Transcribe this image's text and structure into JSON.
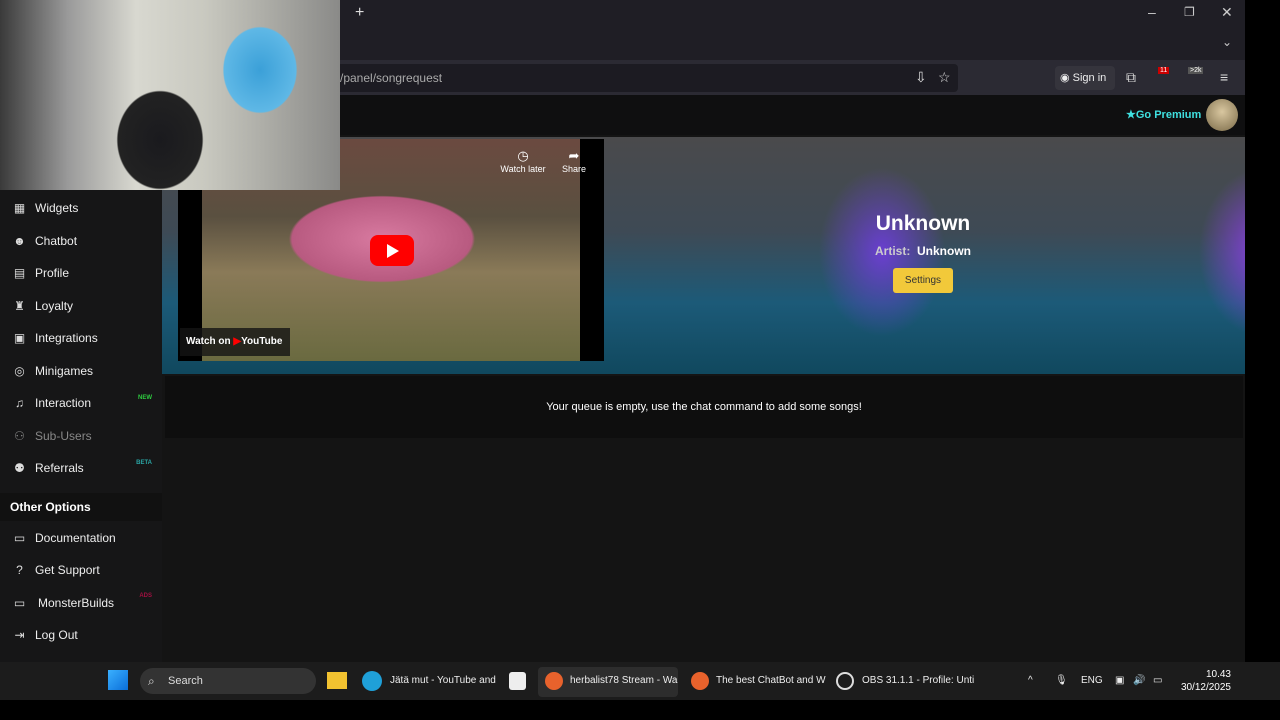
{
  "browser": {
    "url": "/panel/songrequest",
    "sign_in": "Sign in",
    "ext_badge_1": "11",
    "ext_badge_2": ">2k"
  },
  "header": {
    "premium": "Go Premium"
  },
  "sidebar": {
    "items": [
      {
        "label": "Widgets",
        "icon": "▦"
      },
      {
        "label": "Chatbot",
        "icon": "☻"
      },
      {
        "label": "Profile",
        "icon": "▤"
      },
      {
        "label": "Loyalty",
        "icon": "♜"
      },
      {
        "label": "Integrations",
        "icon": "▣"
      },
      {
        "label": "Minigames",
        "icon": "◎"
      },
      {
        "label": "Interaction",
        "icon": "♫",
        "badge": "NEW"
      },
      {
        "label": "Sub-Users",
        "icon": "⚇"
      },
      {
        "label": "Referrals",
        "icon": "⚉",
        "badge": "BETA"
      }
    ],
    "section": "Other Options",
    "other": [
      {
        "label": "Documentation",
        "icon": "▭"
      },
      {
        "label": "Get Support",
        "icon": "?"
      },
      {
        "label": "MonsterBuilds",
        "icon": "▭",
        "badge": "ADS"
      },
      {
        "label": "Log Out",
        "icon": "⇥"
      }
    ]
  },
  "player": {
    "watch_later": "Watch later",
    "share": "Share",
    "watch_on": "Watch on",
    "youtube": "YouTube",
    "title": "Unknown",
    "artist_label": "Artist:",
    "artist": "Unknown",
    "settings": "Settings"
  },
  "queue": {
    "empty": "Your queue is empty, use the chat command to add some songs!"
  },
  "taskbar": {
    "search": "Search",
    "apps": [
      "Jätä mut - YouTube and",
      "herbalist78 Stream - Wa",
      "The best ChatBot and W",
      "OBS 31.1.1 - Profile: Unti"
    ],
    "lang": "ENG",
    "time": "10.43",
    "date": "30/12/2025"
  }
}
